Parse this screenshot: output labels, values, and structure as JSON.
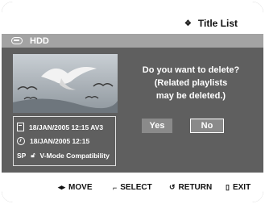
{
  "header": {
    "title": "Title List",
    "title_icon": "diamond-icon"
  },
  "source_bar": {
    "label": "HDD",
    "icon": "hdd-icon"
  },
  "thumbnail": {
    "description_icon": "seagulls-thumbnail"
  },
  "info": {
    "recorded": "18/JAN/2005 12:15 AV3",
    "time": "18/JAN/2005 12:15",
    "mode": "SP",
    "compat": "V-Mode Compatibility"
  },
  "dialog": {
    "line1": "Do you want to delete?",
    "line2": "(Related playlists",
    "line3": "may be deleted.)",
    "yes_label": "Yes",
    "no_label": "No"
  },
  "footer": {
    "move": "MOVE",
    "select": "SELECT",
    "return": "RETURN",
    "exit": "EXIT"
  },
  "colors": {
    "panel": "#5f5f5f",
    "bar": "#a3a3a3",
    "button": "#8a8a8a"
  }
}
